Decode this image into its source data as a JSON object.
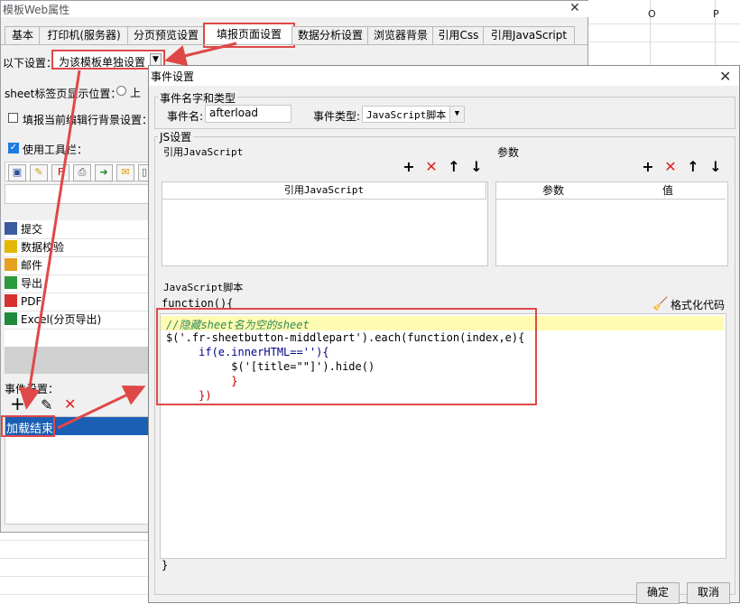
{
  "back_window": {
    "title": "模板Web属性",
    "tabs": [
      "基本",
      "打印机(服务器)",
      "分页预览设置",
      "填报页面设置",
      "数据分析设置",
      "浏览器背景",
      "引用Css",
      "引用JavaScript"
    ],
    "settings_label": "以下设置：",
    "settings_value": "为该模板单独设置",
    "sheet_tab_pos_label": "sheet标签页显示位置：",
    "sheet_tab_pos_option": "上",
    "bg_label": "填报当前编辑行背景设置：",
    "toolbar_label": "使用工具栏：",
    "toolbar_items": [
      "提交",
      "数据校验",
      "邮件",
      "导出",
      "PDF",
      "Excel(分页导出)"
    ],
    "event_label": "事件设置：",
    "event_items": [
      "加载结束"
    ]
  },
  "sheet": {
    "col_headers": [
      "O",
      "P"
    ]
  },
  "dialog": {
    "title": "事件设置",
    "name_type_group": "事件名字和类型",
    "event_name_label": "事件名:",
    "event_name_value": "afterload",
    "event_type_label": "事件类型:",
    "event_type_value": "JavaScript脚本",
    "js_group": "JS设置",
    "ref_js_label": "引用JavaScript",
    "params_label": "参数",
    "ref_js_col": "引用JavaScript",
    "param_col": "参数",
    "value_col": "值",
    "script_label": "JavaScript脚本",
    "function_open": "function(){",
    "format_code": "格式化代码",
    "code_lines": [
      "//隐藏sheet名为空的sheet",
      "$('.fr-sheetbutton-middlepart').each(function(index,e){",
      "     if(e.innerHTML==''){",
      "          $('[title=\"\"]').hide()",
      "          }",
      "     })"
    ],
    "function_close": "}",
    "ok": "确定",
    "cancel": "取消"
  }
}
